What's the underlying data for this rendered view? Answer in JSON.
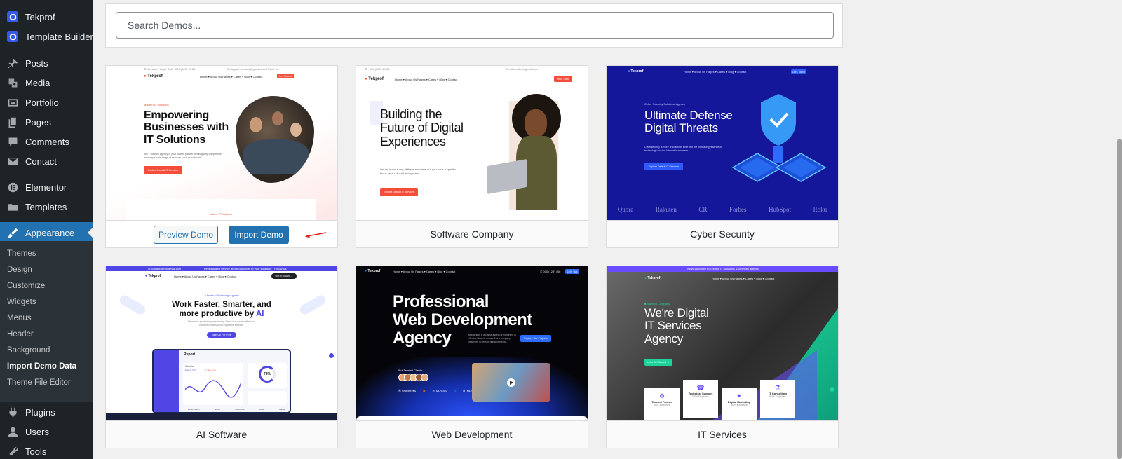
{
  "sidebar": {
    "items": [
      {
        "label": "Tekprof",
        "icon": "tekprof-icon"
      },
      {
        "label": "Template Builder",
        "icon": "template-builder-icon"
      },
      {
        "label": "Posts",
        "icon": "pin-icon"
      },
      {
        "label": "Media",
        "icon": "media-icon"
      },
      {
        "label": "Portfolio",
        "icon": "portfolio-icon"
      },
      {
        "label": "Pages",
        "icon": "pages-icon"
      },
      {
        "label": "Comments",
        "icon": "comment-icon"
      },
      {
        "label": "Contact",
        "icon": "mail-icon"
      },
      {
        "label": "Elementor",
        "icon": "elementor-icon"
      },
      {
        "label": "Templates",
        "icon": "folder-icon"
      },
      {
        "label": "Appearance",
        "icon": "brush-icon"
      },
      {
        "label": "Plugins",
        "icon": "plugin-icon"
      },
      {
        "label": "Users",
        "icon": "user-icon"
      },
      {
        "label": "Tools",
        "icon": "wrench-icon"
      }
    ],
    "submenu": [
      "Themes",
      "Design",
      "Customize",
      "Widgets",
      "Menus",
      "Header",
      "Background",
      "Import Demo Data",
      "Theme File Editor"
    ],
    "current_submenu": "Import Demo Data"
  },
  "search": {
    "placeholder": "Search Demos..."
  },
  "demos": [
    {
      "name": "",
      "preview_label": "Preview Demo",
      "import_label": "Import Demo",
      "thumb": {
        "logo": "Tekprof",
        "tag": "Modern IT Solutions",
        "headline": [
          "Empowering",
          "Businesses with",
          "IT Solutions"
        ],
        "body": "An IT solution agency is your trusted partner in navigating competitive landscape wide range of services such as software.",
        "cta": "Explore Default IT Services",
        "nav": "Home ▾   About Us   Pages ▾   Cases ▾   Blog ▾   Contact",
        "topbar_left": "✆ Need any help? Call: +000 (123) 45 88",
        "topbar_right": "✉ Support: contact@gmail.com    Follow Us",
        "button": "Get Started",
        "footer_tag": "Modern IT Solutions"
      }
    },
    {
      "name": "Software Company",
      "thumb": {
        "logo": "Tekprof",
        "headline": [
          "Building the",
          "Future of Digital",
          "Experiences"
        ],
        "body": "Let me know if any of these resonate or if you have a specific focus area I should incorporate!",
        "cta": "Explore Default IT Services",
        "nav": "Home ▾   About Us   Pages ▾   Cases ▾   Blog ▾   Contact",
        "topbar_left": "✆ +000 (123) 45 88",
        "topbar_right": "✉ admin@info.gmail.com",
        "button": "Hello There"
      }
    },
    {
      "name": "Cyber Security",
      "thumb": {
        "logo": "Tekprof",
        "tag": "Cyber Security Solutions Agency",
        "headline": [
          "Ultimate Defense",
          "Digital Threats"
        ],
        "body": "Cybersecurity is more critical than ever with the increasing reliance on technology and the internet businesses.",
        "cta": "Explore Default IT Services",
        "nav": "Home ▾   About Us   Pages ▾   Cases ▾   Blog ▾   Contact",
        "button": "Let's Touch",
        "brands": [
          "Quora",
          "Rakuten",
          "CR",
          "Forbes",
          "HubSpot",
          "Roku"
        ]
      }
    },
    {
      "name": "AI Software",
      "thumb": {
        "logo": "Tekprof",
        "tag": "● Smart AI Technology Agency",
        "headline_1": "Work Faster, Smarter, and",
        "headline_2": "more productive by ",
        "headline_ai": "AI",
        "body": "Streamline productivity seamlessly. Start today for simplified and optimized professional expansive services.",
        "cta": "Sign Up For Free",
        "nav": "Home ▾   About Us   Pages ▾   Cases ▾   Blog ▾   Contact",
        "topbar_left": "✉ contact@info.gmail.com",
        "topbar_mid": "Personalized service and productivity to your schedule",
        "topbar_right": "Follow Us",
        "button": "Get In Touch →",
        "dash_title": "Report",
        "dash_stat_1": "$ 650,750",
        "dash_stat_2": "$ 780,570",
        "dash_pct": "73%",
        "dash_label": "Statistic",
        "dash_bottom": [
          "Identification",
          "Name",
          "Functions",
          "Date",
          "Status"
        ]
      }
    },
    {
      "name": "Web Development",
      "thumb": {
        "logo": "Tekprof",
        "headline": [
          "Professional",
          "Web Development",
          "Agency"
        ],
        "body": "Web design is a critical aspect of marketing in effective ideas to ensure that a company presence. To remain digital presence.",
        "cta": "Explore Our Projects",
        "nav": "Home ▾   About Us   Pages ▾   Cases ▾   Blog ▾   Contact",
        "phone": "✆ 000 (123) 456",
        "button": "Let's Talk",
        "clients_label": "5k+ Trusted Clients",
        "badges": [
          "WordPress",
          "HTML/CSS",
          "HTML/CSS"
        ]
      }
    },
    {
      "name": "IT Services",
      "thumb": {
        "logo": "Tekprof",
        "tag": "■ Solution Company",
        "headline": [
          "We're Digital",
          "IT Services",
          "Agency"
        ],
        "cta": "Let's Get Started →",
        "nav": "Home ▾   About Us   Pages ▾   Cases ▾   Blog ▾   Contact",
        "topbar": "NEW  Welcome to Tekprof IT Solutions & Services agency",
        "features": [
          {
            "title": "Trusted Partner",
            "sub": "500+ Employee"
          },
          {
            "title": "Technical Support",
            "sub": "500+ Employee"
          },
          {
            "title": "Digital Marketing",
            "sub": "500+ Employee"
          },
          {
            "title": "IT Consulting",
            "sub": "500+ Employee"
          }
        ]
      }
    }
  ],
  "colors": {
    "accent": "#2271b1",
    "sidebar": "#1d2327",
    "cta_red": "#f44e3b",
    "cyber_bg": "#15179a",
    "ai_purple": "#4f46e5"
  }
}
